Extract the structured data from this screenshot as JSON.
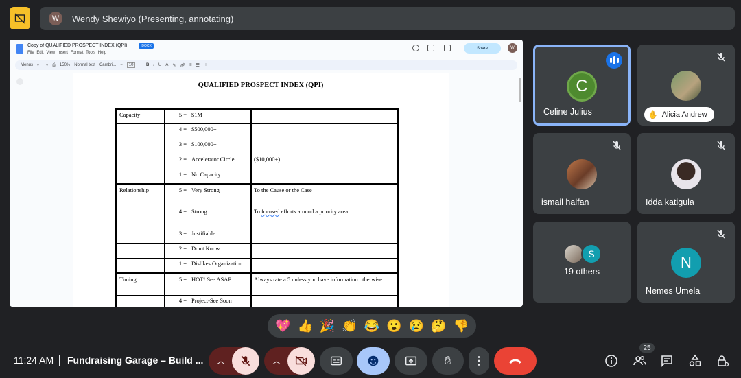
{
  "presenter": {
    "avatar_letter": "W",
    "label": "Wendy Shewiyo (Presenting, annotating)"
  },
  "doc": {
    "title": "Copy of QUALIFIED PROSPECT INDEX (QPI)",
    "badge": ".DOCX",
    "menu": "File Edit View Insert Format Tools Help",
    "share": "Share",
    "avatar_letter": "W",
    "toolbar": {
      "search": "Menus",
      "zoom": "150%",
      "style": "Normal text",
      "font": "Cambri...",
      "size": "10"
    },
    "heading": "QUALIFIED PROSPECT INDEX (QPI)",
    "rows": [
      {
        "cat": "Capacity",
        "score": "5 =",
        "desc": "$1M+",
        "note": ""
      },
      {
        "cat": "",
        "score": "4 =",
        "desc": "$500,000+",
        "note": ""
      },
      {
        "cat": "",
        "score": "3 =",
        "desc": "$100,000+",
        "note": ""
      },
      {
        "cat": "",
        "score": "2 =",
        "desc": "Accelerator Circle",
        "note": "($10,000+)"
      },
      {
        "cat": "",
        "score": "1 =",
        "desc": "No Capacity",
        "note": ""
      },
      {
        "cat": "Relationship",
        "score": "5 =",
        "desc": "Very Strong",
        "note": "To the Cause or the Case"
      },
      {
        "cat": "",
        "score": "4 =",
        "desc": "Strong",
        "note_pre": "To ",
        "note_wavy": "focused",
        "note_post": " efforts around a priority area."
      },
      {
        "cat": "",
        "score": "3 =",
        "desc": "Justifiable",
        "note": ""
      },
      {
        "cat": "",
        "score": "2 =",
        "desc": "Don't Know",
        "note": ""
      },
      {
        "cat": "",
        "score": "1 =",
        "desc": "Dislikes Organization",
        "note": ""
      },
      {
        "cat": "Timing",
        "score": "5 =",
        "desc": "HOT! See ASAP",
        "note": "Always rate a 5 unless you have information otherwise"
      },
      {
        "cat": "",
        "score": "4 =",
        "desc": "Project-See Soon",
        "note": ""
      }
    ]
  },
  "participants": [
    {
      "name": "Celine Julius",
      "letter": "C",
      "color": "#4e8a2f",
      "speaking": true
    },
    {
      "name": "Alicia Andrew",
      "photo": true,
      "muted": true,
      "hand_raised": true
    },
    {
      "name": "ismail halfan",
      "photo": true,
      "muted": true
    },
    {
      "name": "Idda katigula",
      "photo": true,
      "muted": true
    },
    {
      "name": "19 others",
      "letter": "S",
      "color": "#129eaf"
    },
    {
      "name": "Nemes Umela",
      "letter": "N",
      "color": "#129eaf",
      "muted": true
    }
  ],
  "reactions": [
    "💖",
    "👍",
    "🎉",
    "👏",
    "😂",
    "😮",
    "😢",
    "🤔",
    "👎"
  ],
  "bottom": {
    "time": "11:24 AM",
    "meeting_title": "Fundraising Garage – Build ...",
    "people_count": "25"
  },
  "colors": {
    "end_call": "#ea4335",
    "active_control": "#a8c7fa",
    "muted_control": "#f9dedc",
    "presenting_icon": "#f6c029"
  }
}
